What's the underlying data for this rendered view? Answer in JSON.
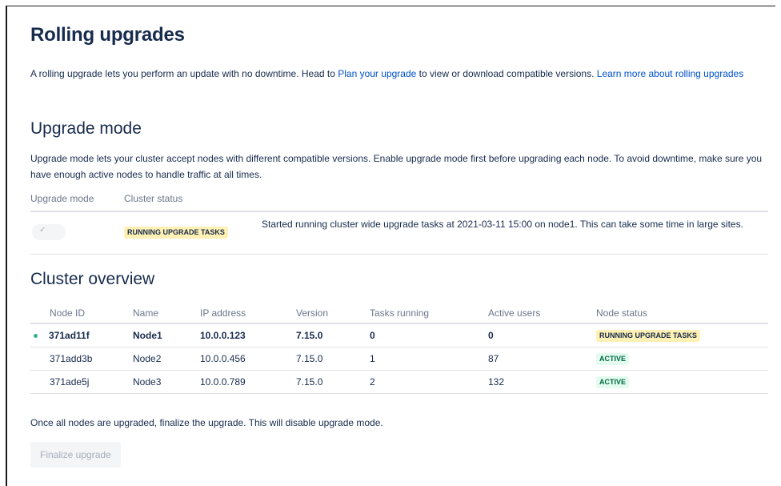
{
  "page": {
    "title": "Rolling upgrades",
    "intro": {
      "text_before_link": "A rolling upgrade lets you perform an update with no downtime. Head to ",
      "plan_link": "Plan your upgrade",
      "text_after_link": " to view or download compatible versions. ",
      "learn_link": "Learn more about rolling upgrades"
    }
  },
  "upgrade_mode": {
    "heading": "Upgrade mode",
    "description": "Upgrade mode lets your cluster accept nodes with different compatible versions. Enable upgrade mode first before upgrading each node. To avoid downtime, make sure you have enough active nodes to handle traffic at all times.",
    "columns": [
      "Upgrade mode",
      "Cluster status"
    ],
    "toggle_enabled": true,
    "toggle_icon": "check-icon",
    "status_lozenge": "RUNNING UPGRADE TASKS",
    "status_text": "Started running cluster wide upgrade tasks at 2021-03-11 15:00 on node1. This can take some time in large sites."
  },
  "cluster": {
    "heading": "Cluster overview",
    "columns": [
      "Node ID",
      "Name",
      "IP address",
      "Version",
      "Tasks running",
      "Active users",
      "Node status"
    ],
    "rows": [
      {
        "node_id": "371ad11f",
        "name": "Node1",
        "ip": "10.0.0.123",
        "version": "7.15.0",
        "tasks": "0",
        "users": "0",
        "status": "RUNNING UPGRADE TASKS",
        "status_color": "yellow",
        "current": true
      },
      {
        "node_id": "371add3b",
        "name": "Node2",
        "ip": "10.0.0.456",
        "version": "7.15.0",
        "tasks": "1",
        "users": "87",
        "status": "ACTIVE",
        "status_color": "green",
        "current": false
      },
      {
        "node_id": "371ade5j",
        "name": "Node3",
        "ip": "10.0.0.789",
        "version": "7.15.0",
        "tasks": "2",
        "users": "132",
        "status": "ACTIVE",
        "status_color": "green",
        "current": false
      }
    ]
  },
  "finalize": {
    "text": "Once all nodes are upgraded, finalize the upgrade. This will disable upgrade mode.",
    "button_label": "Finalize upgrade",
    "button_disabled": true
  },
  "colors": {
    "link": "#0052cc",
    "heading": "#172b4d",
    "lozenge_yellow": "#fff0b3",
    "lozenge_green": "#e3fcef",
    "active_green_text": "#006644",
    "current_dot": "#36b37e"
  }
}
